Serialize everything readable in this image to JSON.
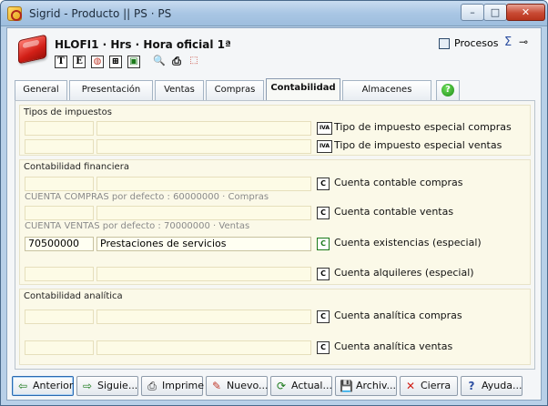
{
  "window": {
    "title": "Sigrid - Producto || PS · PS",
    "controls": {
      "minimize": "–",
      "maximize": "□",
      "close": "✕"
    }
  },
  "header": {
    "product_title": "HLOFI1 · Hrs · Hora oficial 1ª",
    "procesos_label": "Procesos",
    "sigma_icon": "Σ",
    "pin_icon": "⊸",
    "tool_icons": [
      "T",
      "E",
      "◍",
      "⊞",
      "▣",
      "🔍",
      "⎙",
      "⬚"
    ]
  },
  "tabs": [
    {
      "label": "General"
    },
    {
      "label": "Presentación"
    },
    {
      "label": "Ventas"
    },
    {
      "label": "Compras"
    },
    {
      "label": "Contabilidad"
    },
    {
      "label": "Almacenes"
    }
  ],
  "active_tab": "Contabilidad",
  "help_icon": "?",
  "sections": {
    "impuestos": {
      "title": "Tipos de impuestos",
      "rows": [
        {
          "code": "",
          "desc": "",
          "icon": "IVA",
          "label": "Tipo de impuesto especial compras"
        },
        {
          "code": "",
          "desc": "",
          "icon": "IVA",
          "label": "Tipo de impuesto especial ventas"
        }
      ]
    },
    "financiera": {
      "title": "Contabilidad financiera",
      "rows": [
        {
          "code": "",
          "desc": "",
          "icon": "C",
          "label": "Cuenta contable compras",
          "hint": "CUENTA COMPRAS por defecto : 60000000 · Compras"
        },
        {
          "code": "",
          "desc": "",
          "icon": "C",
          "label": "Cuenta contable ventas",
          "hint": "CUENTA VENTAS por defecto : 70000000 · Ventas"
        },
        {
          "code": "70500000",
          "desc": "Prestaciones de servicios",
          "icon": "C",
          "label": "Cuenta existencias (especial)"
        },
        {
          "code": "",
          "desc": "",
          "icon": "C",
          "label": "Cuenta alquileres (especial)"
        }
      ]
    },
    "analitica": {
      "title": "Contabilidad analítica",
      "rows": [
        {
          "code": "",
          "desc": "",
          "icon": "C",
          "label": "Cuenta analítica compras"
        },
        {
          "code": "",
          "desc": "",
          "icon": "C",
          "label": "Cuenta analítica ventas"
        }
      ]
    }
  },
  "buttons": [
    {
      "label": "Anterior",
      "icon": "⇦"
    },
    {
      "label": "Siguie...",
      "icon": "⇨"
    },
    {
      "label": "Imprime",
      "icon": "⎙"
    },
    {
      "label": "Nuevo...",
      "icon": "✎"
    },
    {
      "label": "Actual...",
      "icon": "⟳"
    },
    {
      "label": "Archiv...",
      "icon": "💾"
    },
    {
      "label": "Cierra",
      "icon": "✕"
    },
    {
      "label": "Ayuda...",
      "icon": "?"
    }
  ],
  "colors": {
    "titlebar": "#a9c6e4",
    "close_button": "#c84a34",
    "field_bg": "#fdfbe6",
    "section_bg": "#fbf9e8",
    "hint_text": "#8a8a8a"
  }
}
